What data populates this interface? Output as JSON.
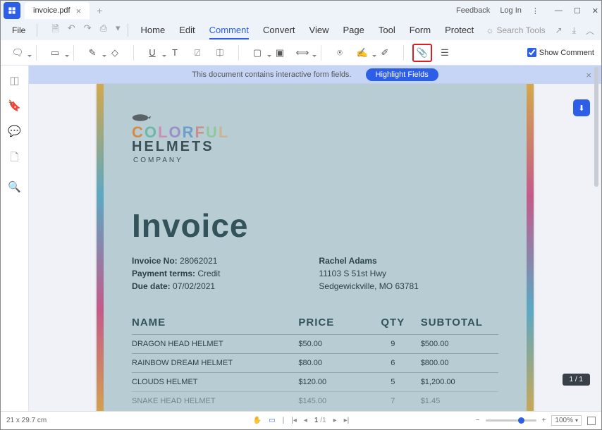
{
  "titlebar": {
    "tab_name": "invoice.pdf",
    "feedback": "Feedback",
    "login": "Log In"
  },
  "menu": {
    "file": "File",
    "tabs": [
      "Home",
      "Edit",
      "Comment",
      "Convert",
      "View",
      "Page",
      "Tool",
      "Form",
      "Protect"
    ],
    "active": "Comment",
    "search": "Search Tools"
  },
  "toolbar": {
    "show_comment": "Show Comment"
  },
  "banner": {
    "message": "This document contains interactive form fields.",
    "button": "Highlight Fields"
  },
  "doc": {
    "logo_line1": "COLORFUL",
    "logo_line2": "HELMETS",
    "logo_line3": "COMPANY",
    "title": "Invoice",
    "meta_left": {
      "invoice_no_label": "Invoice No:",
      "invoice_no": "28062021",
      "terms_label": "Payment terms:",
      "terms": "Credit",
      "due_label": "Due date:",
      "due": "07/02/2021"
    },
    "meta_right": {
      "name": "Rachel Adams",
      "addr1": "11103 S 51st Hwy",
      "addr2": "Sedgewickville, MO 63781"
    },
    "headers": {
      "name": "NAME",
      "price": "PRICE",
      "qty": "QTY",
      "subtotal": "SUBTOTAL"
    },
    "rows": [
      {
        "name": "DRAGON HEAD HELMET",
        "price": "$50.00",
        "qty": "9",
        "subtotal": "$500.00"
      },
      {
        "name": "RAINBOW DREAM HELMET",
        "price": "$80.00",
        "qty": "6",
        "subtotal": "$800.00"
      },
      {
        "name": "CLOUDS HELMET",
        "price": "$120.00",
        "qty": "5",
        "subtotal": "$1,200.00"
      },
      {
        "name": "SNAKE HEAD HELMET",
        "price": "$145.00",
        "qty": "7",
        "subtotal": "$1.45"
      }
    ]
  },
  "page_indicator": "1 / 1",
  "status": {
    "dims": "21 x 29.7 cm",
    "page_current": "1",
    "page_total": "/1",
    "zoom": "100%"
  }
}
